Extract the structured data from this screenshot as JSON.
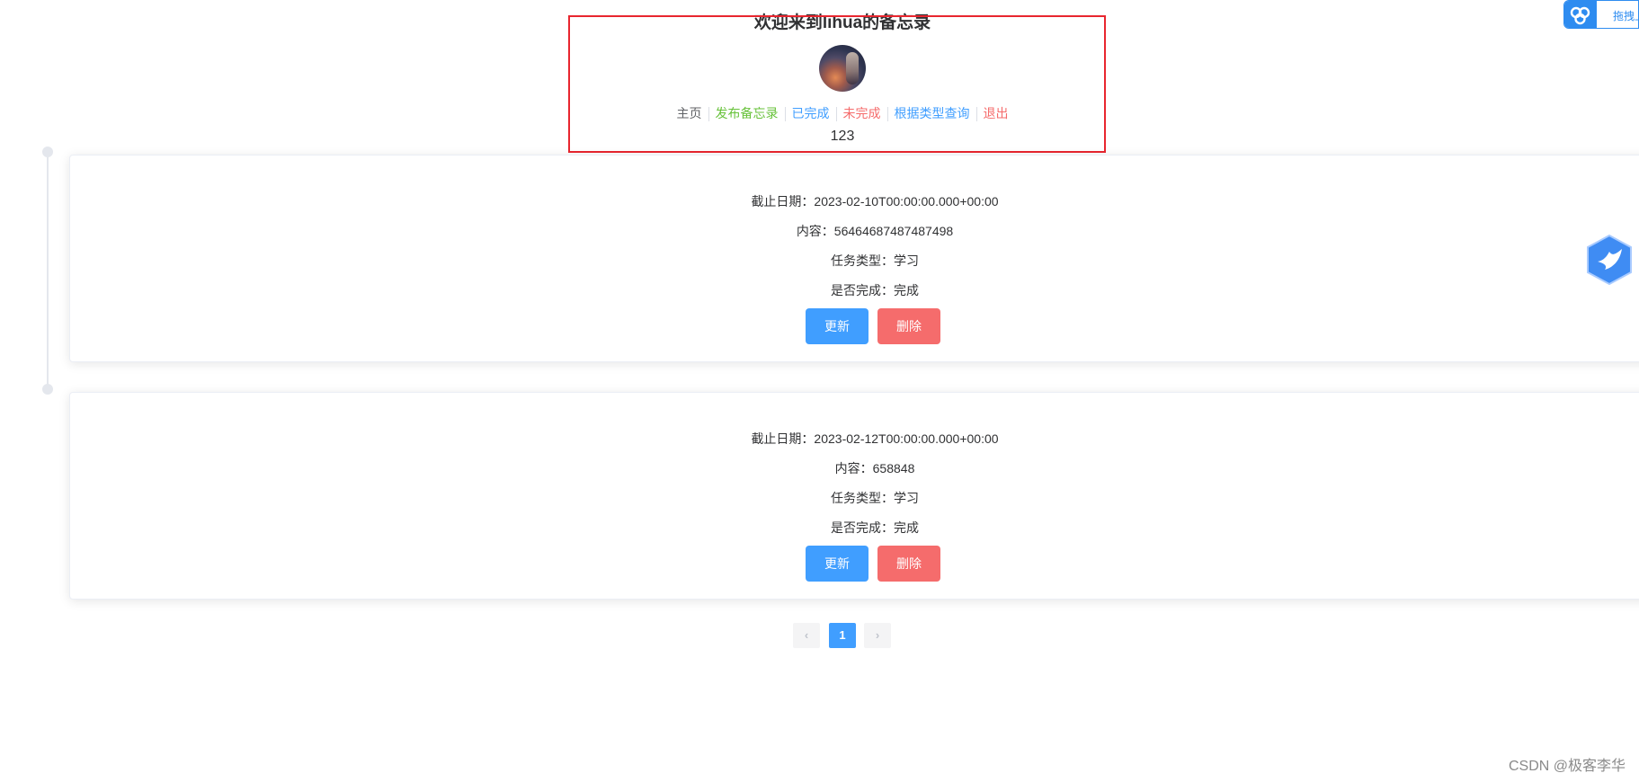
{
  "header": {
    "title": "欢迎来到lihua的备忘录",
    "user_id": "123",
    "nav": [
      {
        "label": "主页",
        "color": "#606266"
      },
      {
        "label": "发布备忘录",
        "color": "#67c23a"
      },
      {
        "label": "已完成",
        "color": "#409eff"
      },
      {
        "label": "未完成",
        "color": "#f56c6c"
      },
      {
        "label": "根据类型查询",
        "color": "#409eff"
      },
      {
        "label": "退出",
        "color": "#f56c6c"
      }
    ]
  },
  "memos": [
    {
      "deadline": "截止日期：2023-02-10T00:00:00.000+00:00",
      "content": "内容：56464687487487498",
      "type": "任务类型：学习",
      "done": "是否完成：完成",
      "update_label": "更新",
      "delete_label": "删除"
    },
    {
      "deadline": "截止日期：2023-02-12T00:00:00.000+00:00",
      "content": "内容：658848",
      "type": "任务类型：学习",
      "done": "是否完成：完成",
      "update_label": "更新",
      "delete_label": "删除"
    }
  ],
  "pagination": {
    "prev": "‹",
    "current": "1",
    "next": "›"
  },
  "widget": {
    "text": "拖拽上",
    "icon": "cloud-icon"
  },
  "floating_icon": "bird-icon",
  "watermark": "CSDN @极客李华",
  "colors": {
    "primary": "#409eff",
    "danger": "#f56c6c",
    "success": "#67c23a",
    "highlight_border": "#e8262f"
  }
}
